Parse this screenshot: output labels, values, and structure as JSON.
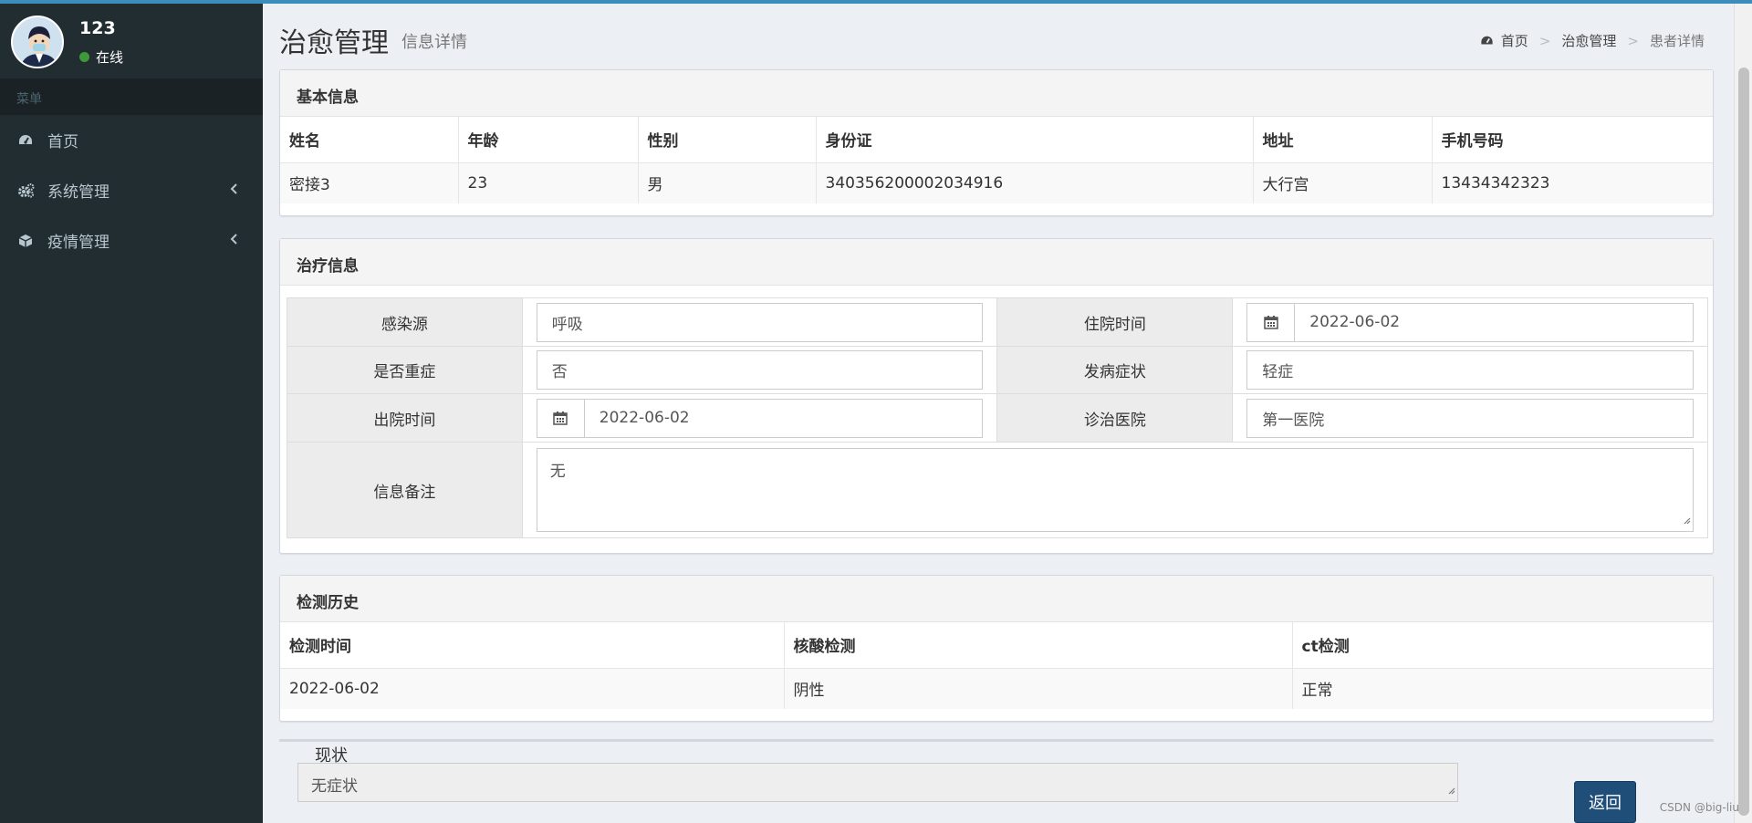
{
  "user": {
    "name": "123",
    "status": "在线"
  },
  "sidebar": {
    "header": "菜单",
    "items": [
      {
        "label": "首页",
        "icon": "dashboard-icon"
      },
      {
        "label": "系统管理",
        "icon": "cogs-icon"
      },
      {
        "label": "疫情管理",
        "icon": "cube-icon"
      }
    ]
  },
  "page": {
    "title": "治愈管理",
    "subtitle": "信息详情"
  },
  "breadcrumb": {
    "home": "首页",
    "section": "治愈管理",
    "current": "患者详情"
  },
  "basic_info": {
    "title": "基本信息",
    "headers": [
      "姓名",
      "年龄",
      "性别",
      "身份证",
      "地址",
      "手机号码"
    ],
    "row": [
      "密接3",
      "23",
      "男",
      "340356200002034916",
      "大行宫",
      "13434342323"
    ]
  },
  "treatment": {
    "title": "治疗信息",
    "infection_source": {
      "label": "感染源",
      "value": "呼吸"
    },
    "admission_time": {
      "label": "住院时间",
      "value": "2022-06-02"
    },
    "severe": {
      "label": "是否重症",
      "value": "否"
    },
    "symptoms": {
      "label": "发病症状",
      "value": "轻症"
    },
    "discharge_time": {
      "label": "出院时间",
      "value": "2022-06-02"
    },
    "hospital": {
      "label": "诊治医院",
      "value": "第一医院"
    },
    "remarks": {
      "label": "信息备注",
      "value": "无"
    }
  },
  "test_history": {
    "title": "检测历史",
    "headers": [
      "检测时间",
      "核酸检测",
      "ct检测"
    ],
    "row": [
      "2022-06-02",
      "阴性",
      "正常"
    ]
  },
  "current_status": {
    "legend": "现状",
    "value": "无症状"
  },
  "actions": {
    "back": "返回"
  },
  "watermark": "CSDN @big-liu",
  "colors": {
    "sidebar": "#222d32",
    "accent": "#3c8dbc",
    "button": "#1f4e79",
    "online": "#3c9a3c"
  }
}
